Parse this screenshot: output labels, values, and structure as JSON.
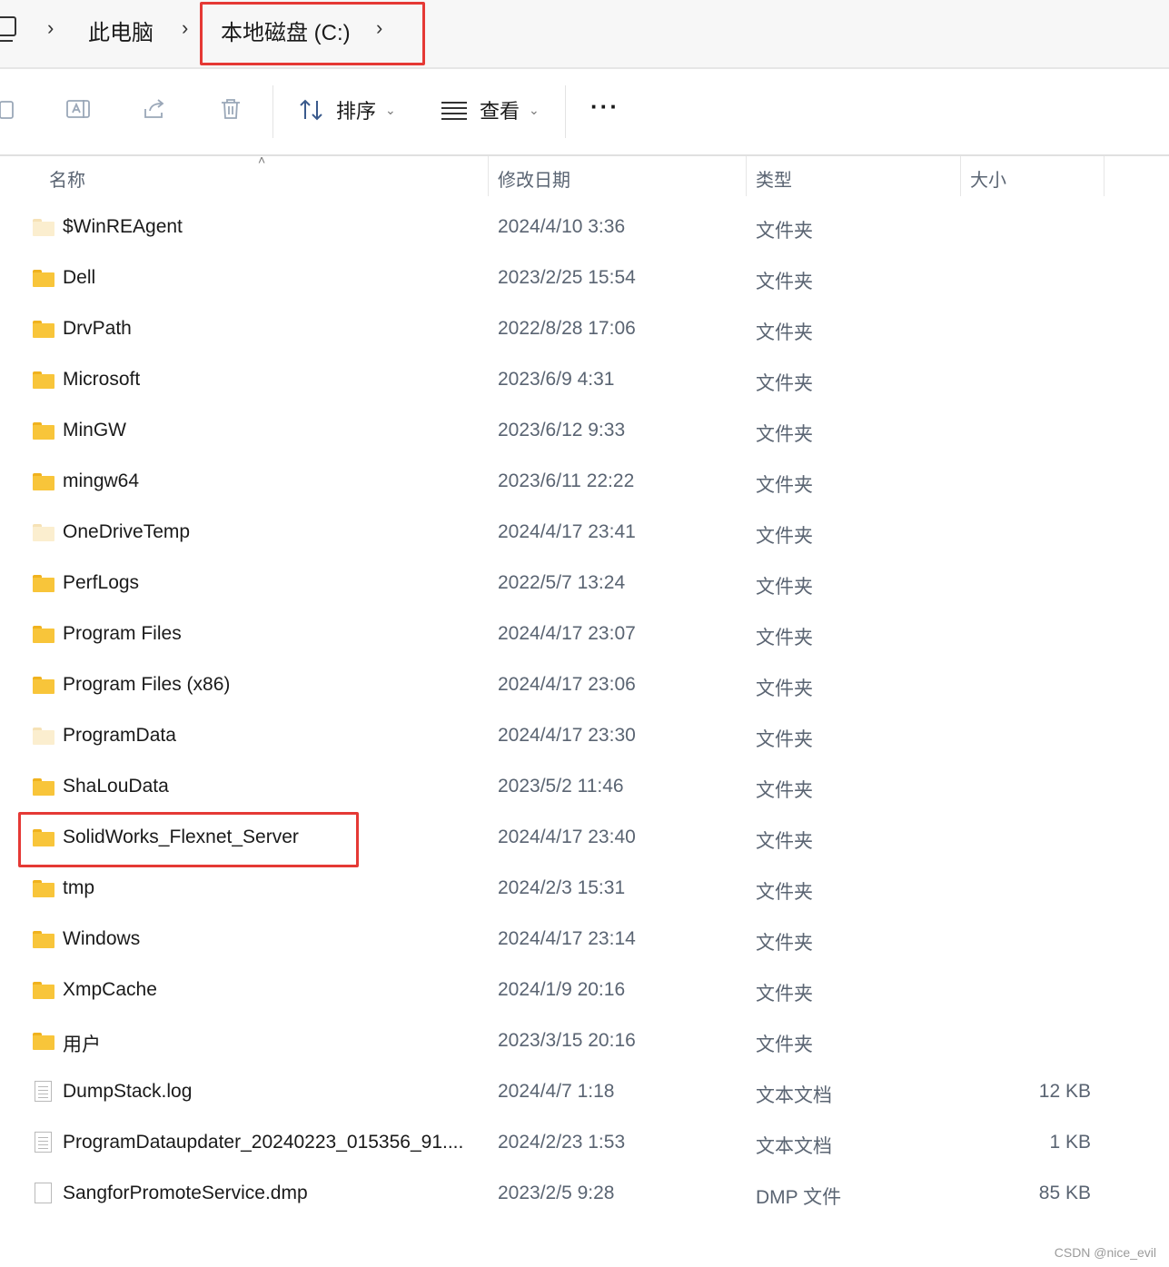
{
  "breadcrumb": {
    "items": [
      "此电脑",
      "本地磁盘 (C:)"
    ],
    "separator": "›"
  },
  "toolbar": {
    "sort_label": "排序",
    "view_label": "查看",
    "more_label": "···"
  },
  "columns": {
    "name": "名称",
    "date": "修改日期",
    "type": "类型",
    "size": "大小"
  },
  "rows": [
    {
      "name": "$WinREAgent",
      "date": "2024/4/10 3:36",
      "type": "文件夹",
      "size": "",
      "icon": "folder-pale-icon"
    },
    {
      "name": "Dell",
      "date": "2023/2/25 15:54",
      "type": "文件夹",
      "size": "",
      "icon": "folder-icon"
    },
    {
      "name": "DrvPath",
      "date": "2022/8/28 17:06",
      "type": "文件夹",
      "size": "",
      "icon": "folder-icon"
    },
    {
      "name": "Microsoft",
      "date": "2023/6/9 4:31",
      "type": "文件夹",
      "size": "",
      "icon": "folder-icon"
    },
    {
      "name": "MinGW",
      "date": "2023/6/12 9:33",
      "type": "文件夹",
      "size": "",
      "icon": "folder-icon"
    },
    {
      "name": "mingw64",
      "date": "2023/6/11 22:22",
      "type": "文件夹",
      "size": "",
      "icon": "folder-icon"
    },
    {
      "name": "OneDriveTemp",
      "date": "2024/4/17 23:41",
      "type": "文件夹",
      "size": "",
      "icon": "folder-pale-icon"
    },
    {
      "name": "PerfLogs",
      "date": "2022/5/7 13:24",
      "type": "文件夹",
      "size": "",
      "icon": "folder-icon"
    },
    {
      "name": "Program Files",
      "date": "2024/4/17 23:07",
      "type": "文件夹",
      "size": "",
      "icon": "folder-icon"
    },
    {
      "name": "Program Files (x86)",
      "date": "2024/4/17 23:06",
      "type": "文件夹",
      "size": "",
      "icon": "folder-icon"
    },
    {
      "name": "ProgramData",
      "date": "2024/4/17 23:30",
      "type": "文件夹",
      "size": "",
      "icon": "folder-pale-icon"
    },
    {
      "name": "ShaLouData",
      "date": "2023/5/2 11:46",
      "type": "文件夹",
      "size": "",
      "icon": "folder-icon"
    },
    {
      "name": "SolidWorks_Flexnet_Server",
      "date": "2024/4/17 23:40",
      "type": "文件夹",
      "size": "",
      "icon": "folder-icon"
    },
    {
      "name": "tmp",
      "date": "2024/2/3 15:31",
      "type": "文件夹",
      "size": "",
      "icon": "folder-icon"
    },
    {
      "name": "Windows",
      "date": "2024/4/17 23:14",
      "type": "文件夹",
      "size": "",
      "icon": "folder-icon"
    },
    {
      "name": "XmpCache",
      "date": "2024/1/9 20:16",
      "type": "文件夹",
      "size": "",
      "icon": "folder-icon"
    },
    {
      "name": "用户",
      "date": "2023/3/15 20:16",
      "type": "文件夹",
      "size": "",
      "icon": "folder-icon"
    },
    {
      "name": "DumpStack.log",
      "date": "2024/4/7 1:18",
      "type": "文本文档",
      "size": "12 KB",
      "icon": "text-file-icon"
    },
    {
      "name": "ProgramDataupdater_20240223_015356_91....",
      "date": "2024/2/23 1:53",
      "type": "文本文档",
      "size": "1 KB",
      "icon": "text-file-icon"
    },
    {
      "name": "SangforPromoteService.dmp",
      "date": "2023/2/5 9:28",
      "type": "DMP 文件",
      "size": "85 KB",
      "icon": "file-icon"
    }
  ],
  "watermark": "CSDN @nice_evil",
  "colors": {
    "highlight": "#e53935",
    "folder": "#f8c53a",
    "folder_pale": "#fbeecf",
    "secondary_text": "#5a6472"
  }
}
